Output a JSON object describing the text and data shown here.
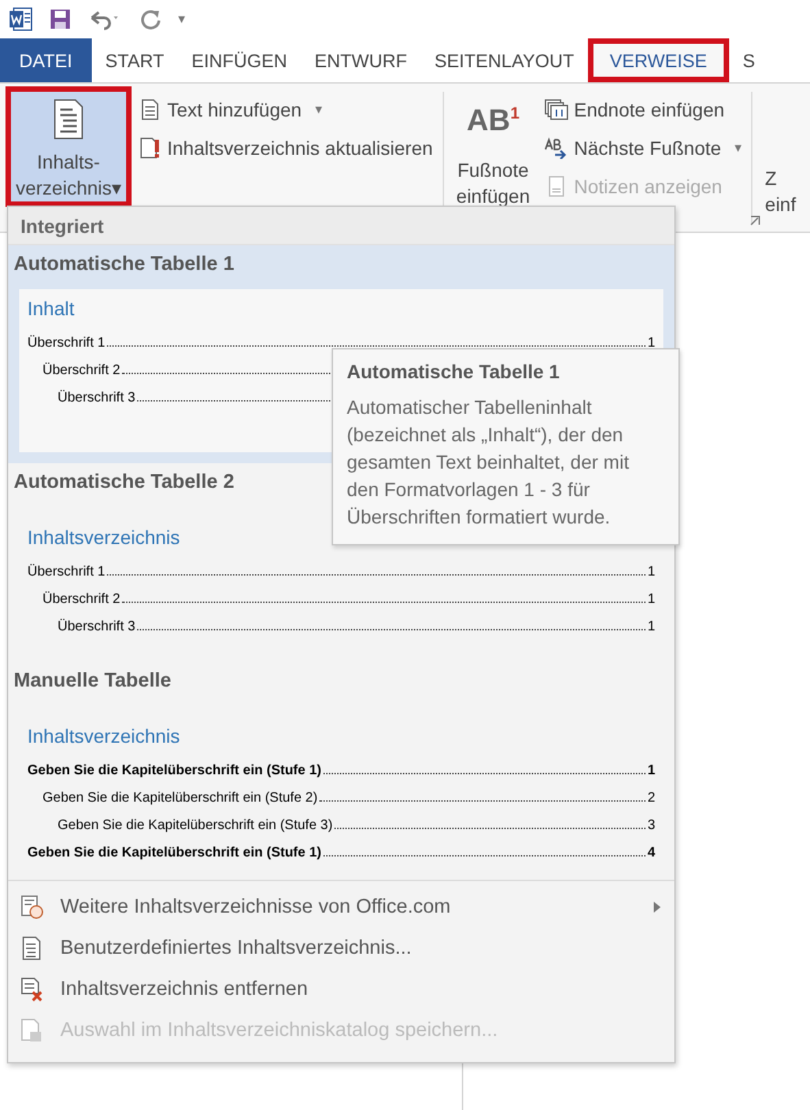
{
  "quick_access": {
    "customize_caret": "▾"
  },
  "tabs": [
    {
      "label": "DATEI",
      "kind": "file",
      "selected": false,
      "highlighted": false
    },
    {
      "label": "START",
      "kind": "tab",
      "selected": false,
      "highlighted": false
    },
    {
      "label": "EINFÜGEN",
      "kind": "tab",
      "selected": false,
      "highlighted": false
    },
    {
      "label": "ENTWURF",
      "kind": "tab",
      "selected": false,
      "highlighted": false
    },
    {
      "label": "SEITENLAYOUT",
      "kind": "tab",
      "selected": false,
      "highlighted": false
    },
    {
      "label": "VERWEISE",
      "kind": "tab",
      "selected": true,
      "highlighted": true
    },
    {
      "label": "S",
      "kind": "tab",
      "selected": false,
      "highlighted": false
    }
  ],
  "ribbon": {
    "toc_button": {
      "lines": [
        "Inhalts-",
        "verzeichnis"
      ],
      "caret": "▾",
      "pressed": true,
      "highlighted": true
    },
    "toc_small": [
      {
        "label": "Text hinzufügen",
        "caret": "▾",
        "disabled": false
      },
      {
        "label": "Inhaltsverzeichnis aktualisieren",
        "disabled": false
      }
    ],
    "footnote_button": {
      "glyph": "AB",
      "sup": "1",
      "lines": [
        "Fußnote",
        "einfügen"
      ]
    },
    "footnote_small": [
      {
        "label": "Endnote einfügen",
        "disabled": false
      },
      {
        "label": "Nächste Fußnote",
        "caret": "▾",
        "disabled": false
      },
      {
        "label": "Notizen anzeigen",
        "disabled": true
      }
    ],
    "cut_button": {
      "lines": [
        "Z",
        "einf"
      ]
    }
  },
  "dropdown": {
    "header": "Integriert",
    "galleries": [
      {
        "title": "Automatische Tabelle 1",
        "selected": true,
        "heading": "Inhalt",
        "entries": [
          {
            "text": "Überschrift 1",
            "page": "1",
            "bold": false,
            "children": [
              {
                "text": "Überschrift 2",
                "bold": false,
                "children": [
                  {
                    "text": "Überschrift 3",
                    "bold": false
                  }
                ]
              }
            ]
          }
        ]
      },
      {
        "title": "Automatische Tabelle 2",
        "selected": false,
        "heading": "Inhaltsverzeichnis",
        "entries": [
          {
            "text": "Überschrift 1",
            "page": "1",
            "bold": false,
            "children": [
              {
                "text": "Überschrift 2",
                "page": "1",
                "bold": false,
                "children": [
                  {
                    "text": "Überschrift 3",
                    "page": "1",
                    "bold": false
                  }
                ]
              }
            ]
          }
        ]
      },
      {
        "title": "Manuelle Tabelle",
        "selected": false,
        "heading": "Inhaltsverzeichnis",
        "entries": [
          {
            "text": "Geben Sie die Kapitelüberschrift ein (Stufe 1)",
            "page": "1",
            "bold": true,
            "children": [
              {
                "text": "Geben Sie die Kapitelüberschrift ein (Stufe 2)",
                "page": "2",
                "bold": false,
                "children": [
                  {
                    "text": "Geben Sie die Kapitelüberschrift ein (Stufe 3)",
                    "page": "3",
                    "bold": false
                  }
                ]
              }
            ]
          },
          {
            "text": "Geben Sie die Kapitelüberschrift ein (Stufe 1)",
            "page": "4",
            "bold": true
          }
        ]
      }
    ],
    "menu": [
      {
        "label": "Weitere Inhaltsverzeichnisse von Office.com",
        "kind": "web",
        "submenu": true,
        "disabled": false
      },
      {
        "label": "Benutzerdefiniertes Inhaltsverzeichnis...",
        "kind": "custom",
        "submenu": false,
        "disabled": false
      },
      {
        "label": "Inhaltsverzeichnis entfernen",
        "kind": "remove",
        "submenu": false,
        "disabled": false
      },
      {
        "label": "Auswahl im Inhaltsverzeichniskatalog speichern...",
        "kind": "save",
        "submenu": false,
        "disabled": true
      }
    ]
  },
  "tooltip": {
    "title": "Automatische Tabelle 1",
    "text": "Automatischer Tabelleninhalt (bezeichnet als „Inhalt“), der den gesamten Text beinhaltet, der mit den Formatvorlagen 1 - 3 für Überschriften formatiert wurde."
  }
}
